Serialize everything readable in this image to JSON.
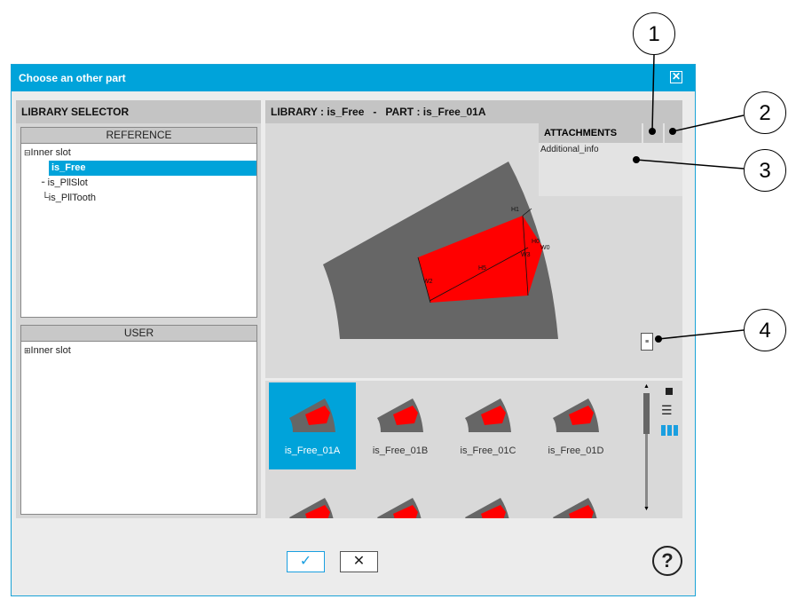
{
  "window": {
    "title": "Choose an other part"
  },
  "left": {
    "title": "LIBRARY SELECTOR",
    "reference": {
      "header": "REFERENCE",
      "root": "Inner slot",
      "items": [
        "is_Free",
        "is_PllSlot",
        "is_PllTooth"
      ],
      "selected": "is_Free"
    },
    "user": {
      "header": "USER",
      "root": "Inner slot"
    }
  },
  "right": {
    "title": "LIBRARY : is_Free   -   PART : is_Free_01A",
    "attachments": {
      "header": "ATTACHMENTS",
      "items": [
        "Additional_info"
      ]
    },
    "dims": [
      "H1",
      "H0",
      "W0",
      "W3",
      "H5",
      "W2"
    ],
    "gallery": [
      "is_Free_01A",
      "is_Free_01B",
      "is_Free_01C",
      "is_Free_01D"
    ],
    "selected": "is_Free_01A"
  },
  "callouts": [
    "1",
    "2",
    "3",
    "4"
  ],
  "colors": {
    "accent": "#00a3da",
    "slot": "#ff0000",
    "lamination": "#666666"
  }
}
